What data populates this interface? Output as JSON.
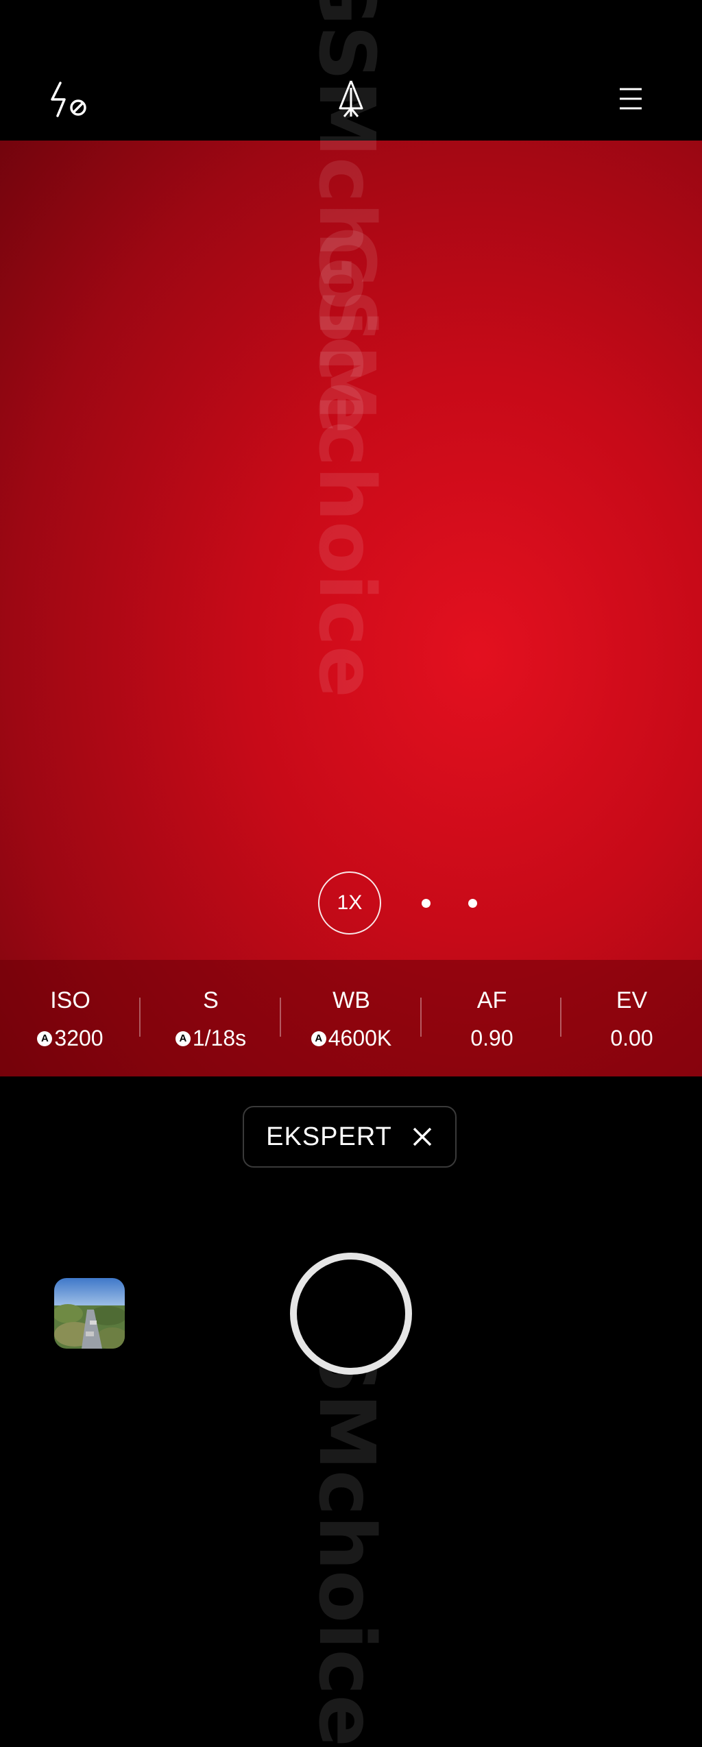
{
  "top_bar": {
    "flash_icon": "flash-off-icon",
    "scene_icon": "tree-icon",
    "menu_icon": "menu-icon"
  },
  "viewfinder": {
    "colors": {
      "center": "#e3101f",
      "edge": "#6d040c"
    },
    "zoom": {
      "label": "1X"
    },
    "watermark": {
      "text": "GSMchoice"
    }
  },
  "params": [
    {
      "label": "ISO",
      "value": "3200",
      "auto": true
    },
    {
      "label": "S",
      "value": "1/18s",
      "auto": true
    },
    {
      "label": "WB",
      "value": "4600K",
      "auto": true
    },
    {
      "label": "AF",
      "value": "0.90",
      "auto": false
    },
    {
      "label": "EV",
      "value": "0.00",
      "auto": false
    }
  ],
  "auto_badge": "A",
  "mode": {
    "label": "EKSPERT",
    "close_icon": "close-icon"
  },
  "bottom": {
    "gallery_icon": "gallery-thumbnail",
    "shutter_icon": "shutter-button"
  }
}
